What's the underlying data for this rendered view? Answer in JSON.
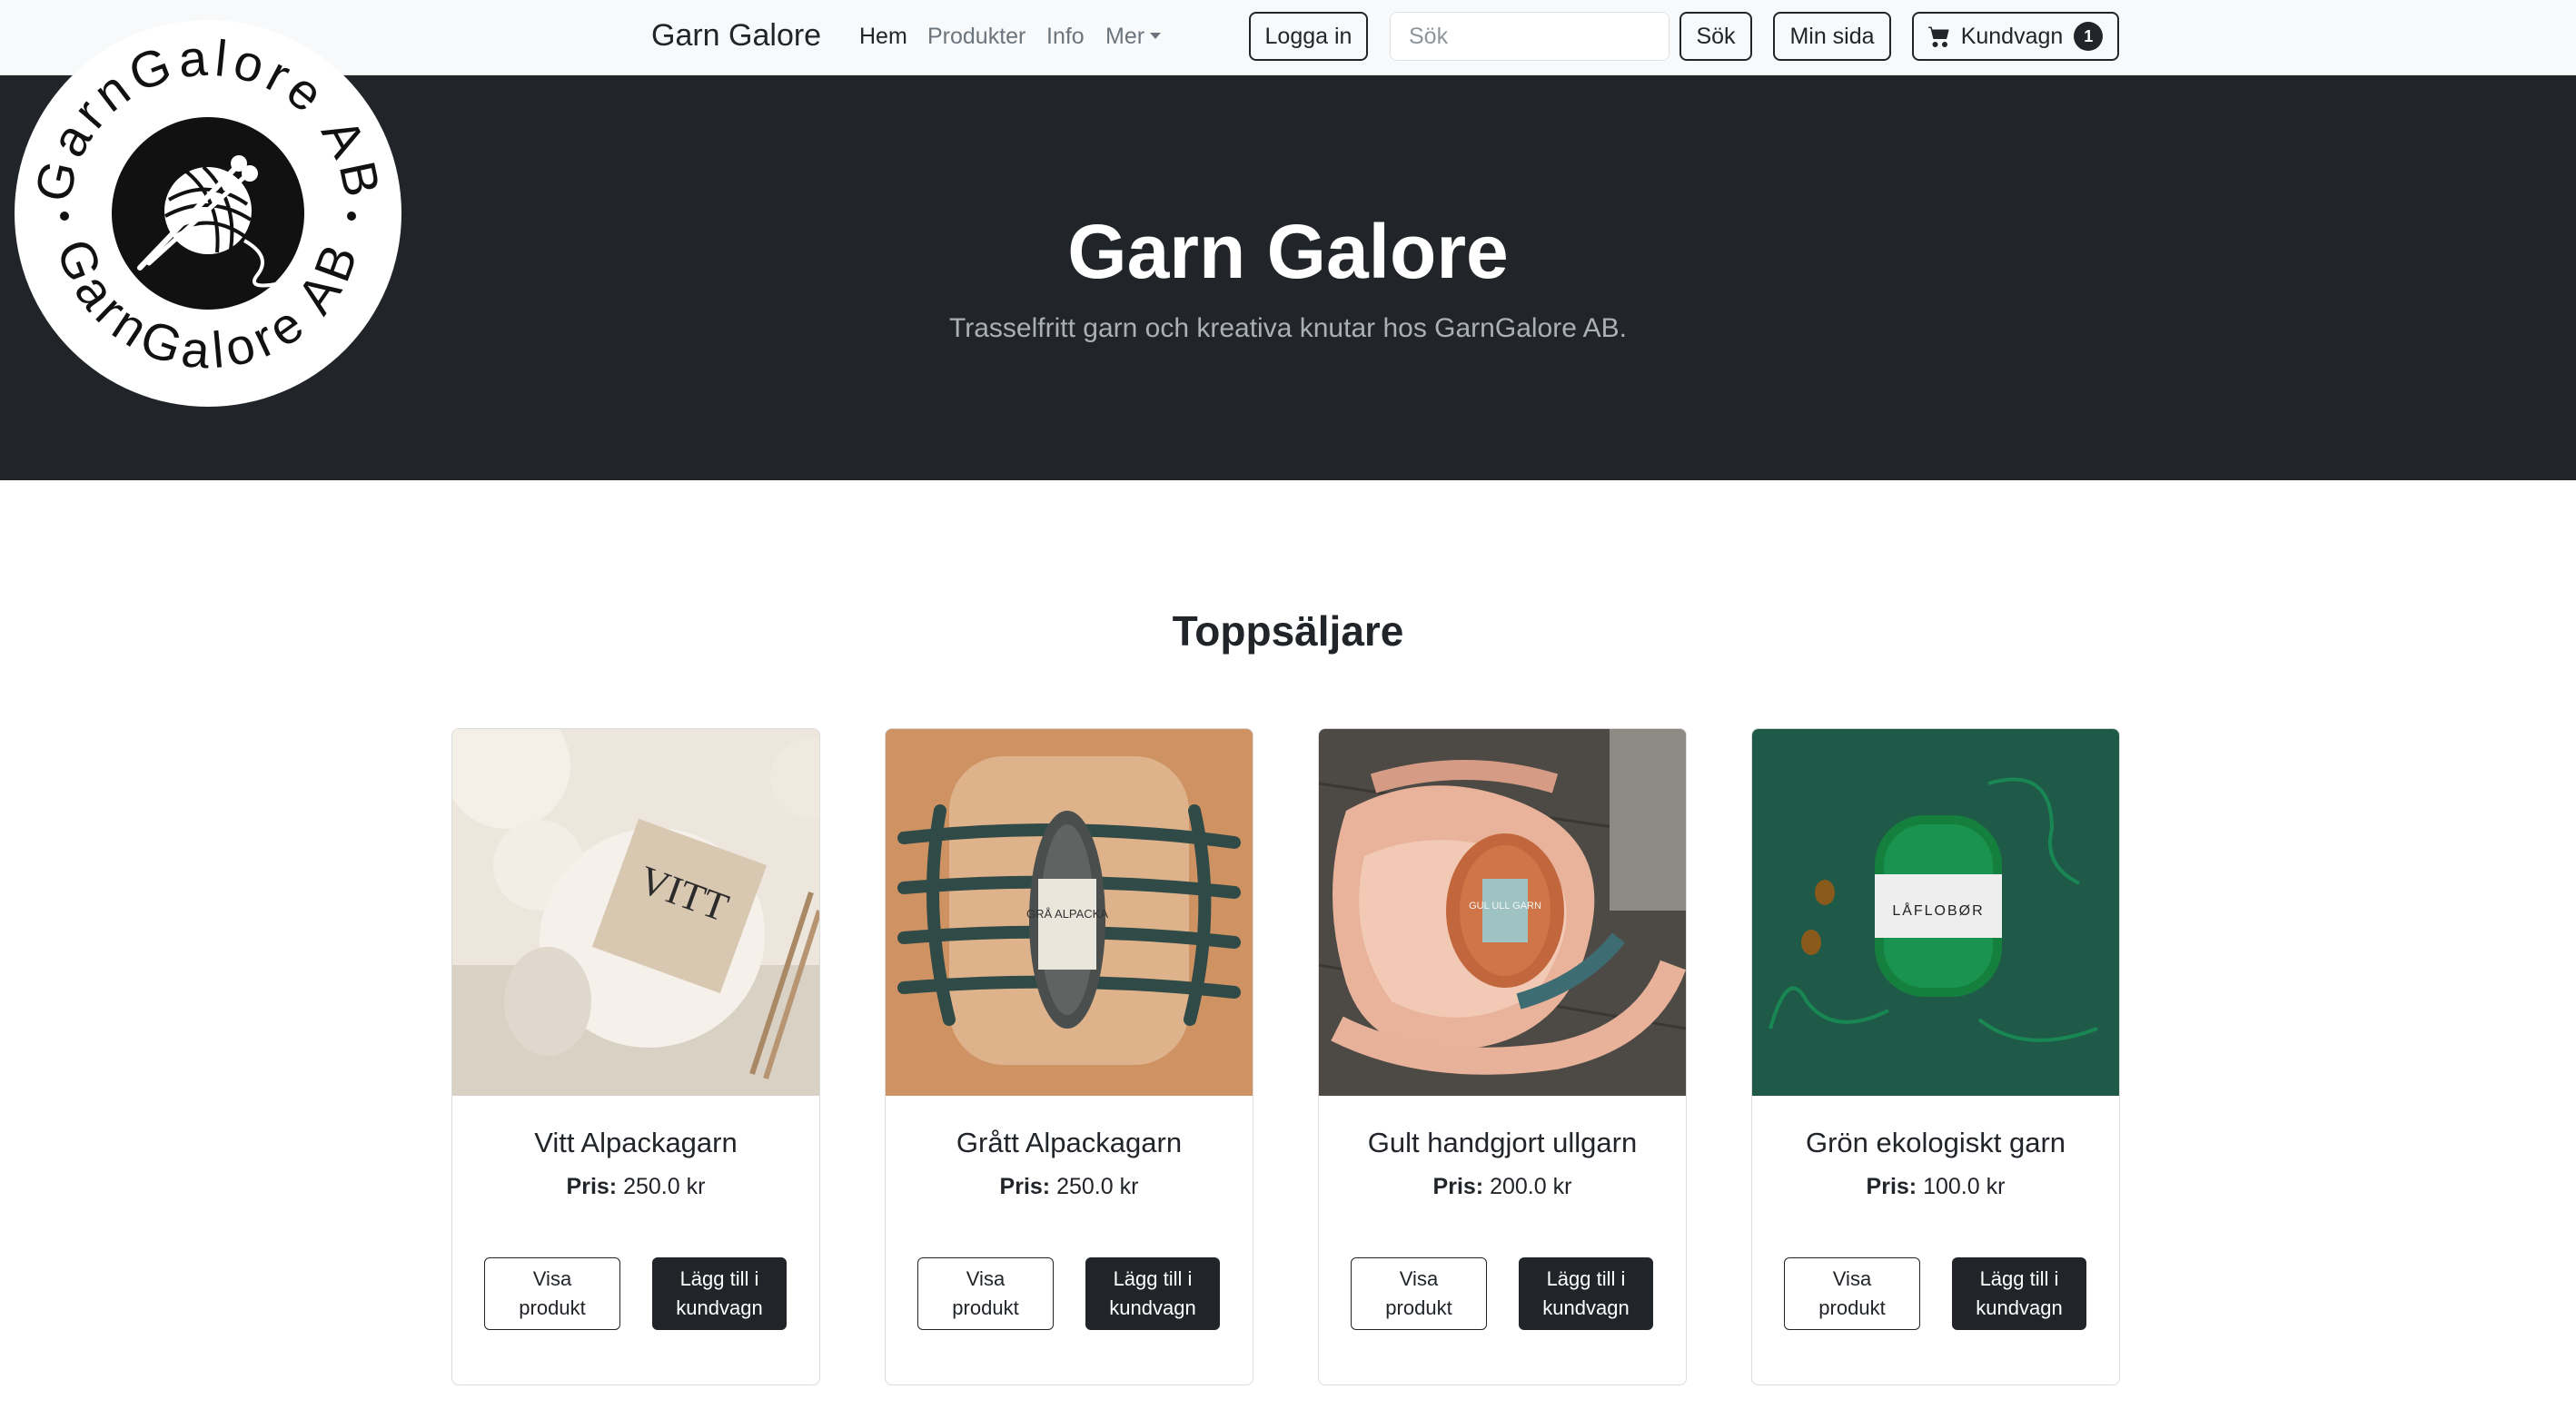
{
  "navbar": {
    "brand": "Garn Galore",
    "links": [
      {
        "label": "Hem",
        "active": true
      },
      {
        "label": "Produkter"
      },
      {
        "label": "Info"
      },
      {
        "label": "Mer"
      }
    ],
    "login_label": "Logga in",
    "search_placeholder": "Sök",
    "search_button": "Sök",
    "account_label": "Min sida",
    "cart_label": "Kundvagn",
    "cart_count": "1"
  },
  "logo": {
    "text_top": "GarnGalore AB",
    "text_bottom": "GarnGalore AB",
    "icon": "yarn-ball-with-needles-icon"
  },
  "hero": {
    "title": "Garn Galore",
    "subtitle": "Trasselfritt garn och kreativa knutar hos GarnGalore AB."
  },
  "section_title": "Toppsäljare",
  "price_label": "Pris:",
  "products": [
    {
      "name": "Vitt Alpackagarn",
      "price": "250.0 kr",
      "image": "white-alpaca-yarn-image",
      "label_text": "VITT"
    },
    {
      "name": "Grått Alpackagarn",
      "price": "250.0 kr",
      "image": "gray-alpaca-yarn-image",
      "label_text": "GRÅ ALPACKA"
    },
    {
      "name": "Gult handgjort ullgarn",
      "price": "200.0 kr",
      "image": "handmade-wool-yarn-image",
      "label_text": "GUL ULL GARN"
    },
    {
      "name": "Grön ekologiskt garn",
      "price": "100.0 kr",
      "image": "green-organic-yarn-image",
      "label_text": "LÅFLOBØR"
    }
  ],
  "buttons": {
    "view_line1": "Visa",
    "view_line2": "produkt",
    "add_line1": "Lägg till i",
    "add_line2": "kundvagn"
  },
  "colors": {
    "dark": "#212529",
    "navbar_bg": "#f8f9fa",
    "muted": "#6c757d"
  }
}
